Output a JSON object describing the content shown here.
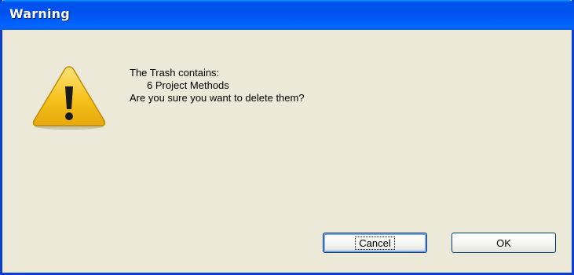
{
  "window": {
    "title": "Warning"
  },
  "icon": "warning-triangle-icon",
  "message": {
    "line1": "The Trash contains:",
    "line2": "6 Project Methods",
    "line3": "Are you sure you want to delete them?"
  },
  "buttons": {
    "cancel_label": "Cancel",
    "ok_label": "OK"
  },
  "colors": {
    "titlebar": "#0053ee",
    "background": "#ece9d8",
    "warning_yellow": "#f7c520"
  }
}
